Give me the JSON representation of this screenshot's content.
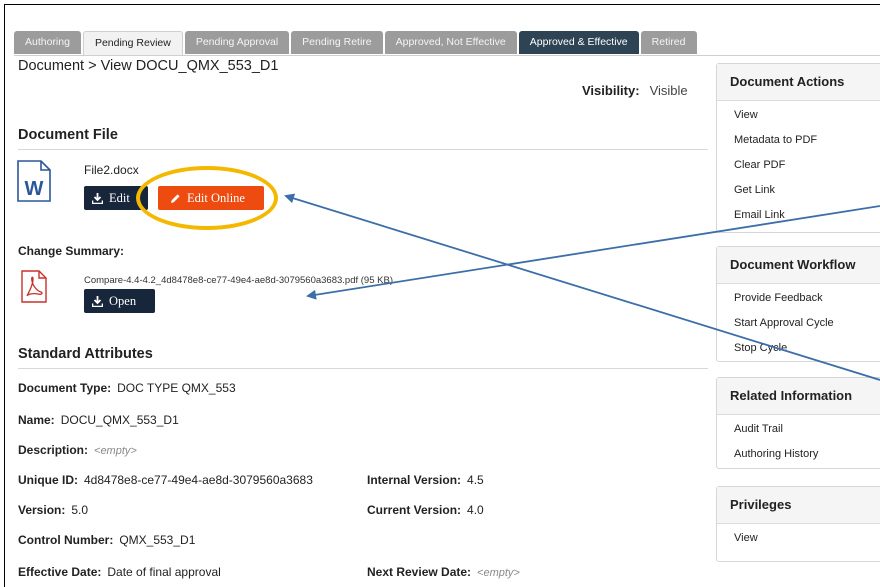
{
  "tabs": [
    {
      "label": "Authoring",
      "state": "inactive"
    },
    {
      "label": "Pending Review",
      "state": "active"
    },
    {
      "label": "Pending Approval",
      "state": "inactive"
    },
    {
      "label": "Pending Retire",
      "state": "inactive"
    },
    {
      "label": "Approved, Not Effective",
      "state": "inactive"
    },
    {
      "label": "Approved & Effective",
      "state": "dark"
    },
    {
      "label": "Retired",
      "state": "inactive"
    }
  ],
  "breadcrumb": "Document > View DOCU_QMX_553_D1",
  "visibility": {
    "label": "Visibility:",
    "value": "Visible"
  },
  "document_file": {
    "title": "Document File",
    "file_name": "File2.docx",
    "edit_label": "Edit",
    "edit_online_label": "Edit Online",
    "icon": "word-document-icon"
  },
  "change_summary": {
    "label": "Change Summary:",
    "file_name": "Compare-4.4-4.2_4d8478e8-ce77-49e4-ae8d-3079560a3683.pdf (95 KB)",
    "open_label": "Open",
    "icon": "pdf-document-icon"
  },
  "standard_attributes": {
    "title": "Standard Attributes",
    "document_type": {
      "label": "Document Type:",
      "value": "DOC TYPE QMX_553"
    },
    "name": {
      "label": "Name:",
      "value": "DOCU_QMX_553_D1"
    },
    "description": {
      "label": "Description:",
      "value": "<empty>"
    },
    "unique_id": {
      "label": "Unique ID:",
      "value": "4d8478e8-ce77-49e4-ae8d-3079560a3683"
    },
    "internal_version": {
      "label": "Internal Version:",
      "value": "4.5"
    },
    "version": {
      "label": "Version:",
      "value": "5.0"
    },
    "current_version": {
      "label": "Current Version:",
      "value": "4.0"
    },
    "control_number": {
      "label": "Control Number:",
      "value": "QMX_553_D1"
    },
    "effective_date": {
      "label": "Effective Date:",
      "value": "Date of final approval"
    },
    "next_review_date": {
      "label": "Next Review Date:",
      "value": "<empty>"
    }
  },
  "panels": {
    "document_actions": {
      "title": "Document Actions",
      "items": [
        "View",
        "Metadata to PDF",
        "Clear PDF",
        "Get Link",
        "Email Link"
      ]
    },
    "document_workflow": {
      "title": "Document Workflow",
      "items": [
        "Provide Feedback",
        "Start Approval Cycle",
        "Stop Cycle"
      ]
    },
    "related_information": {
      "title": "Related Information",
      "items": [
        "Audit Trail",
        "Authoring History"
      ]
    },
    "privileges": {
      "title": "Privileges",
      "items": [
        "View"
      ]
    }
  },
  "colors": {
    "edit_online_button": "#ee4b10",
    "dark_button": "#17263b",
    "highlight": "#f5b800",
    "arrow": "#3d6ea8",
    "dark_tab": "#2e4354"
  }
}
